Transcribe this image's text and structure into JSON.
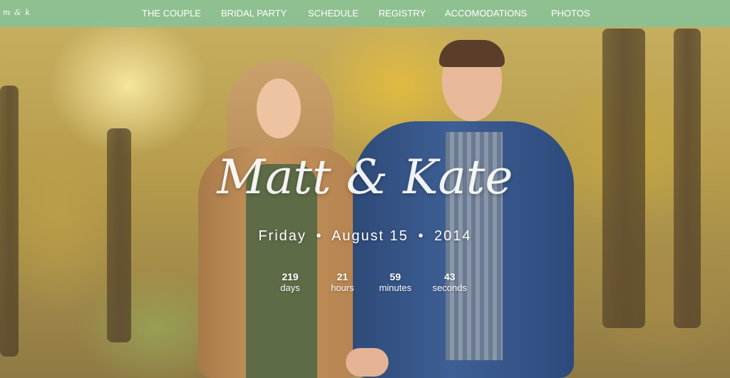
{
  "site": {
    "logo": "m & k"
  },
  "nav": {
    "items": [
      {
        "label": "THE COUPLE"
      },
      {
        "label": "BRIDAL PARTY"
      },
      {
        "label": "SCHEDULE"
      },
      {
        "label": "REGISTRY"
      },
      {
        "label": "ACCOMODATIONS"
      },
      {
        "label": "PHOTOS"
      }
    ]
  },
  "hero": {
    "names": "Matt & Kate",
    "date": {
      "weekday": "Friday",
      "month_day": "August 15",
      "year": "2014",
      "separator": "•"
    },
    "countdown": {
      "days": {
        "value": "219",
        "label": "days"
      },
      "hours": {
        "value": "21",
        "label": "hours"
      },
      "minutes": {
        "value": "59",
        "label": "minutes"
      },
      "seconds": {
        "value": "43",
        "label": "seconds"
      }
    }
  },
  "colors": {
    "nav_background": "#85c296",
    "text": "#ffffff"
  }
}
